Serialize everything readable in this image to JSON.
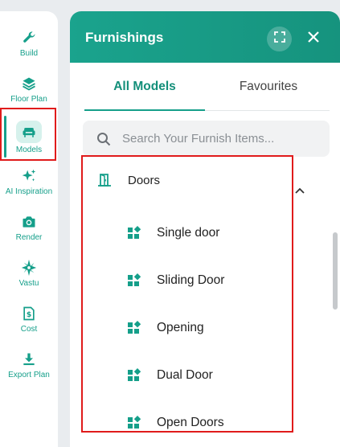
{
  "colors": {
    "accent": "#159f8a",
    "highlight": "#e01b1b"
  },
  "sidebar": {
    "items": [
      {
        "label": "Build",
        "icon": "wrench-icon"
      },
      {
        "label": "Floor Plan",
        "icon": "layers-icon"
      },
      {
        "label": "Models",
        "icon": "sofa-icon",
        "active": true
      },
      {
        "label": "AI Inspiration",
        "icon": "sparkles-icon"
      },
      {
        "label": "Render",
        "icon": "camera-icon"
      },
      {
        "label": "Vastu",
        "icon": "compass-star-icon"
      },
      {
        "label": "Cost",
        "icon": "cost-icon"
      },
      {
        "label": "Export Plan",
        "icon": "download-icon"
      }
    ]
  },
  "panel": {
    "title": "Furnishings",
    "tabs": [
      {
        "label": "All Models",
        "active": true
      },
      {
        "label": "Favourites"
      }
    ],
    "search": {
      "placeholder": "Search Your Furnish Items..."
    },
    "category": {
      "label": "Doors",
      "icon": "door-icon",
      "items": [
        {
          "label": "Single door",
          "icon": "model-icon"
        },
        {
          "label": "Sliding Door",
          "icon": "model-icon"
        },
        {
          "label": "Opening",
          "icon": "model-icon"
        },
        {
          "label": "Dual Door",
          "icon": "model-icon"
        },
        {
          "label": "Open Doors",
          "icon": "model-icon"
        }
      ]
    }
  }
}
